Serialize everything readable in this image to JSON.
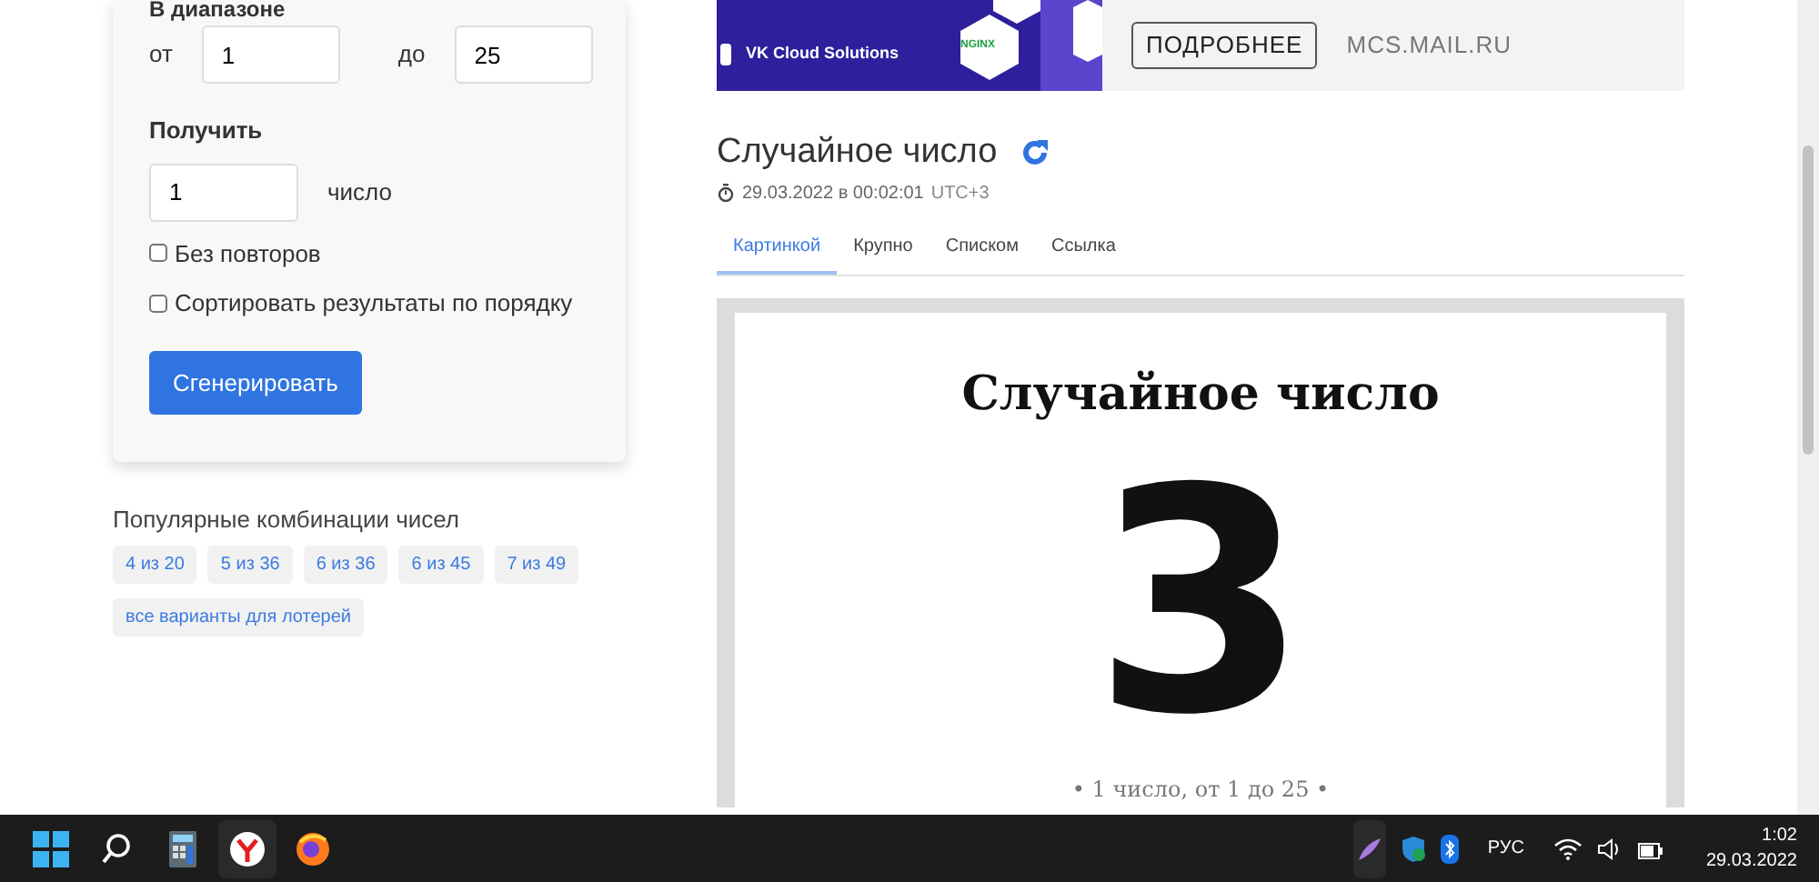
{
  "range": {
    "label": "В диапазоне",
    "from_label": "от",
    "from_value": "1",
    "to_label": "до",
    "to_value": "25"
  },
  "get": {
    "label": "Получить",
    "value": "1",
    "unit": "число"
  },
  "options": [
    {
      "label": "Без повторов",
      "checked": false
    },
    {
      "label": "Сортировать результаты по порядку",
      "checked": false
    }
  ],
  "generate_button": "Сгенерировать",
  "popular": {
    "title": "Популярные комбинации чисел",
    "tags": [
      "4 из 20",
      "5 из 36",
      "6 из 36",
      "6 из 45",
      "7 из 49",
      "все варианты для лотерей"
    ]
  },
  "ad": {
    "brand": "VK Cloud Solutions",
    "badge": "NGINX",
    "button": "ПОДРОБНЕЕ",
    "domain": "MCS.MAIL.RU"
  },
  "result": {
    "title": "Случайное число",
    "date": "29.03.2022 в 00:02:01",
    "timezone": "UTC+3",
    "tabs": [
      {
        "label": "Картинкой",
        "selected": true
      },
      {
        "label": "Крупно",
        "selected": false
      },
      {
        "label": "Списком",
        "selected": false
      },
      {
        "label": "Ссылка",
        "selected": false
      }
    ],
    "image": {
      "title": "Случайное число",
      "number": "3",
      "caption": "• 1 число, от 1 до 25 •"
    }
  },
  "taskbar": {
    "language": "РУС",
    "time": "1:02",
    "date": "29.03.2022"
  }
}
